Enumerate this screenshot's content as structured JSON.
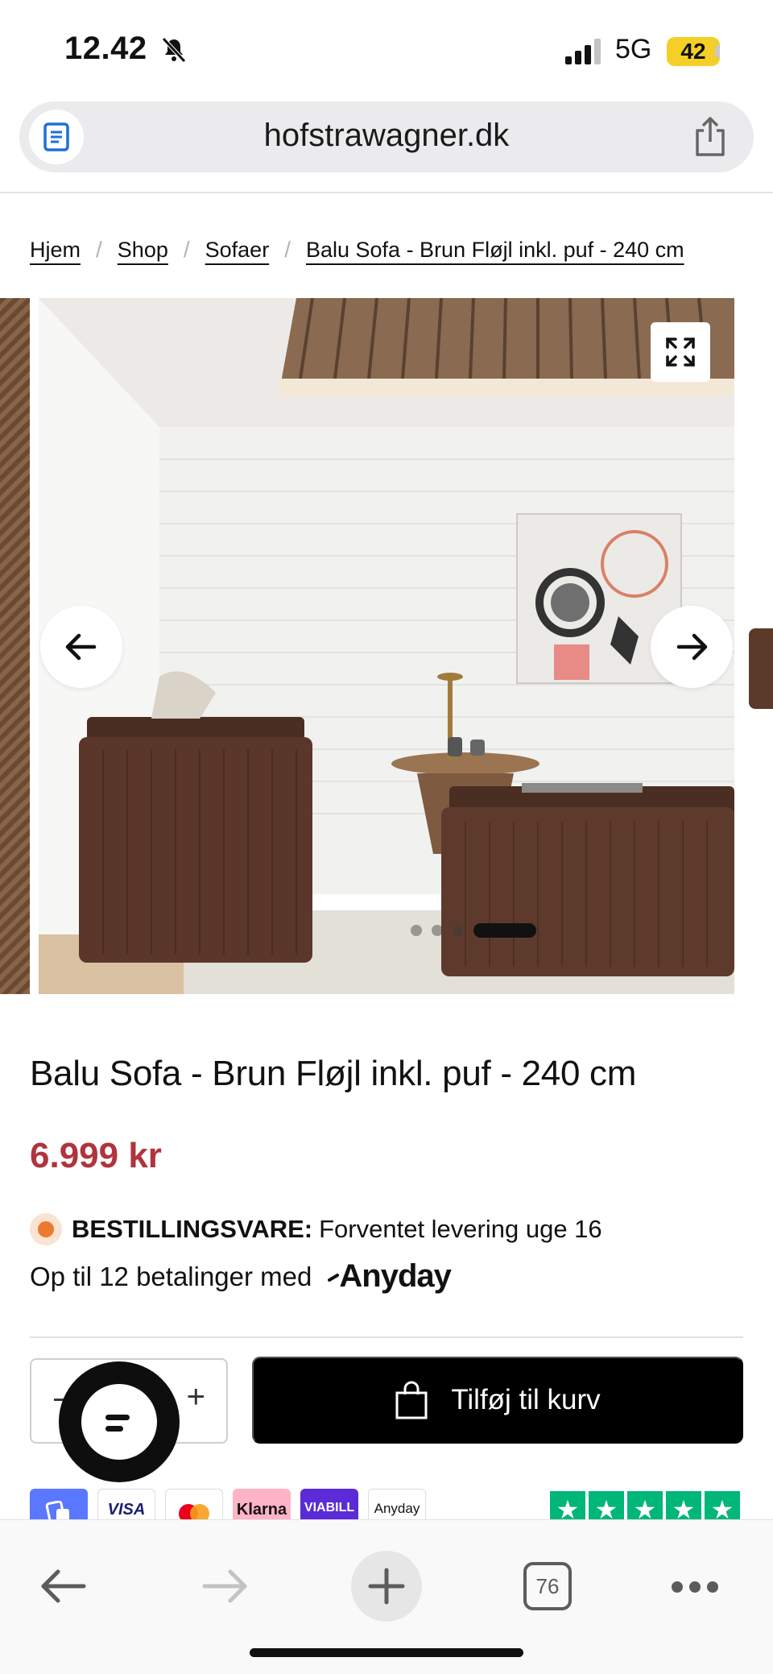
{
  "status_bar": {
    "time": "12.42",
    "network": "5G",
    "battery": "42"
  },
  "browser": {
    "url": "hofstrawagner.dk",
    "tab_count": "76"
  },
  "breadcrumb": {
    "items": [
      "Hjem",
      "Shop",
      "Sofaer",
      "Balu Sofa - Brun Fløjl inkl. puf - 240 cm"
    ],
    "separator": "/"
  },
  "gallery": {
    "slide_count": 4,
    "active_slide": 4
  },
  "product": {
    "title": "Balu Sofa - Brun Fløjl inkl. puf - 240 cm",
    "price": "6.999 kr",
    "stock_label": "BESTILLINGSVARE:",
    "stock_text": "Forventet levering uge 16",
    "financing_text": "Op til 12 betalinger med",
    "financing_brand": "Anyday"
  },
  "cart": {
    "minus": "−",
    "plus": "+",
    "add_label": "Tilføj til kurv"
  },
  "payments": {
    "visa": "VISA",
    "klarna": "Klarna",
    "viabill": "VIABILL",
    "anyday": "Anyday"
  },
  "colors": {
    "price": "#b0343c",
    "stock_dot": "#ec7a2e",
    "trustpilot": "#00b67a",
    "cart_button": "#000000"
  }
}
